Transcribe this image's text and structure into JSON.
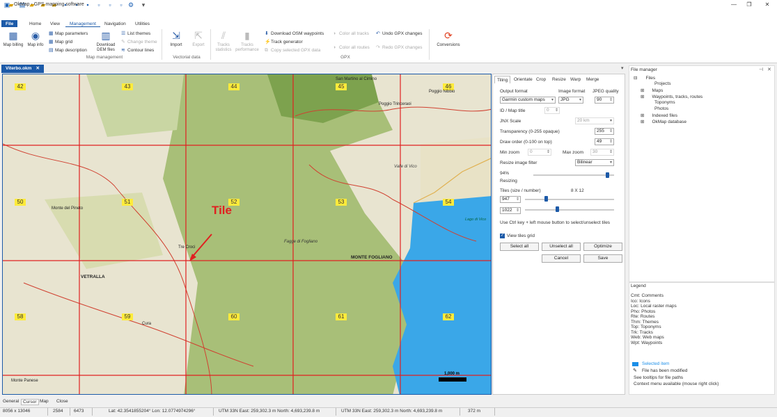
{
  "titlebar": {
    "title": "OkMap - GPS mapping software"
  },
  "ribbon_tabs": [
    "File",
    "Home",
    "View",
    "Management",
    "Navigation",
    "Utilities"
  ],
  "ribbon": {
    "map_billing": "Map billing",
    "map_info": "Map info",
    "map_parameters": "Map parameters",
    "map_grid": "Map grid",
    "map_description": "Map description",
    "download_dem": "Download DEM files",
    "list_themes": "List themes",
    "change_theme": "Change theme",
    "contour_lines": "Contour lines",
    "group_map_management": "Map management",
    "import": "Import",
    "export": "Export",
    "group_vectorial": "Vectorial data",
    "tracks_statistics": "Tracks statistics",
    "tracks_performance": "Tracks performance",
    "download_osm": "Download OSM waypoints",
    "track_generator": "Track generator",
    "copy_gpx": "Copy selected GPX data",
    "color_all_tracks": "Color all tracks",
    "color_all_routes": "Color all routes",
    "undo_gpx": "Undo GPX changes",
    "redo_gpx": "Redo GPX changes",
    "group_gpx": "GPX",
    "conversions": "Conversions"
  },
  "doc_tab": "Viterbo.okm",
  "map": {
    "tile_label": "Tile",
    "tiles": [
      "42",
      "43",
      "44",
      "45",
      "46",
      "50",
      "51",
      "52",
      "53",
      "54",
      "58",
      "59",
      "60",
      "61",
      "62"
    ],
    "places": [
      "Poggio Nibbio",
      "Poggio Trinceraoi",
      "Monte del Pineto",
      "Tre Croci",
      "MONTE FOGLIANO",
      "VETRALLA",
      "Cura",
      "Monte Panese",
      "Lago di Vico",
      "Valle di Vico",
      "San Martino al Cimino",
      "Fagge di Fogliano"
    ],
    "scale": "1,000 m"
  },
  "panel": {
    "tabs": [
      "Tiling",
      "Orientate",
      "Crop",
      "Resize",
      "Warp",
      "Merge"
    ],
    "output_format_label": "Output format",
    "output_format": "Garmin custom maps",
    "image_format_label": "Image format",
    "image_format": "JPG",
    "jpeg_quality_label": "JPEG quality",
    "jpeg_quality": "90",
    "id_label": "ID / Map title",
    "id_value": "0",
    "jnx_label": "JNX Scale",
    "jnx_value": "20 km",
    "transparency_label": "Transparency (0-255 opaque)",
    "transparency": "255",
    "draw_order_label": "Draw order (0-100 on top)",
    "draw_order": "49",
    "min_zoom_label": "Min zoom",
    "min_zoom": "0",
    "max_zoom_label": "Max zoom",
    "max_zoom": "30",
    "resize_filter_label": "Resize image filter",
    "resize_filter": "Bilinear",
    "resizing_pct": "94%",
    "resizing_label": "Resizing",
    "resizing_level": 0.94,
    "tiles_label": "Tiles (size / number)",
    "tiles_count": "8  X  12",
    "tile_w": "947",
    "tile_h": "1022",
    "hint": "Use Ctrl key + left mouse button to select/unselect tiles",
    "view_grid": "View tiles grid",
    "select_all": "Select all",
    "unselect_all": "Unselect all",
    "optimize": "Optimize",
    "cancel": "Cancel",
    "save": "Save"
  },
  "file_manager": {
    "title": "File manager",
    "root": "Files",
    "items": [
      "Projects",
      "Maps",
      "Waypoints, tracks, routes",
      "Toponyms",
      "Photos",
      "Indexed files",
      "OkMap database"
    ]
  },
  "legend": {
    "title": "Legend",
    "entries": [
      "Cmt: Comments",
      "Ico: Icons",
      "Loc: Local raster maps",
      "Pho: Photos",
      "Rte: Routes",
      "Thm: Themes",
      "Top: Toponyms",
      "Trk: Tracks",
      "Web: Web maps",
      "Wpt: Waypoints"
    ],
    "selected": "Selected item",
    "modified": "File has been modified",
    "tooltips": "See tooltips for file paths",
    "context": "Context menu available (mouse right click)"
  },
  "bottom_tabs": [
    "General",
    "Cursor",
    "Map",
    "Close"
  ],
  "status": {
    "size": "8056 x 13046",
    "v1": "2584",
    "v2": "6473",
    "latlon": "Lat: 42.3541855204°  Lon: 12.0774974296°",
    "utm1": "UTM 33N  East: 259,302.3  m  North: 4,693,239.8  m",
    "utm2": "UTM 33N  East: 259,302.3  m  North: 4,693,239.8  m",
    "alt": "372 m"
  },
  "colors": {
    "accent": "#1c5aa8",
    "grid": "#e02020",
    "lake": "#3aa7e8",
    "forest": "#8cae5c",
    "tilenum": "#ffeb3b"
  }
}
